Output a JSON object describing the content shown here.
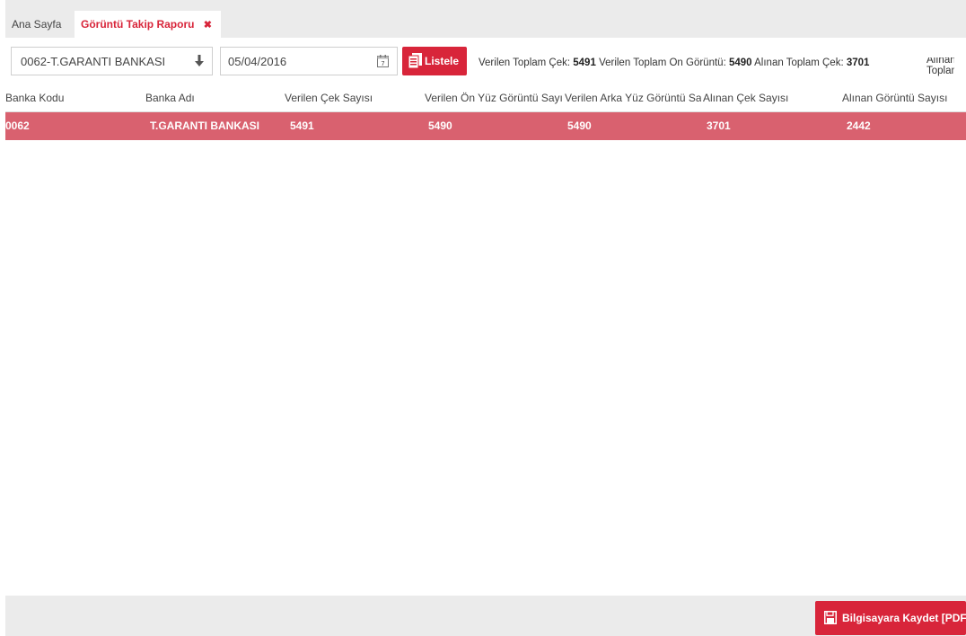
{
  "tabs": {
    "home_label": "Ana Sayfa",
    "active_label": "Görüntü Takip Raporu",
    "close_glyph": "✖"
  },
  "filters": {
    "bank_value": "0062-T.GARANTI BANKASI",
    "date_value": "05/04/2016",
    "list_button_label": "Listele"
  },
  "summary": {
    "sent_cheque_label": "Verilen Toplam Çek:",
    "sent_cheque_value": "5491",
    "sent_front_label": "Verilen Toplam Ön Görüntü:",
    "sent_front_value": "5490",
    "received_cheque_label": "Alınan Toplam Çek:",
    "received_cheque_value": "3701",
    "received_images_label": "Alınan Toplam"
  },
  "table": {
    "columns": [
      "Banka Kodu",
      "Banka Adı",
      "Verilen Çek Sayısı",
      "Verilen Ön Yüz Görüntü Sayısı",
      "Verilen Arka Yüz Görüntü Sayısı",
      "Alınan Çek Sayısı",
      "Alınan Görüntü Sayısı"
    ],
    "rows": [
      [
        "0062",
        "T.GARANTI BANKASI",
        "5491",
        "5490",
        "5490",
        "3701",
        "2442"
      ]
    ]
  },
  "footer": {
    "pdf_button_label": "Bilgisayara Kaydet [PDF]"
  },
  "colors": {
    "accent": "#d8253a",
    "selected_row": "#d9616f",
    "chrome_gray": "#ebebeb"
  },
  "icons": {
    "bank_dropdown": "arrow-down-icon",
    "date_picker": "calendar-icon",
    "list_button": "document-list-icon",
    "pdf_button": "floppy-disk-icon"
  }
}
